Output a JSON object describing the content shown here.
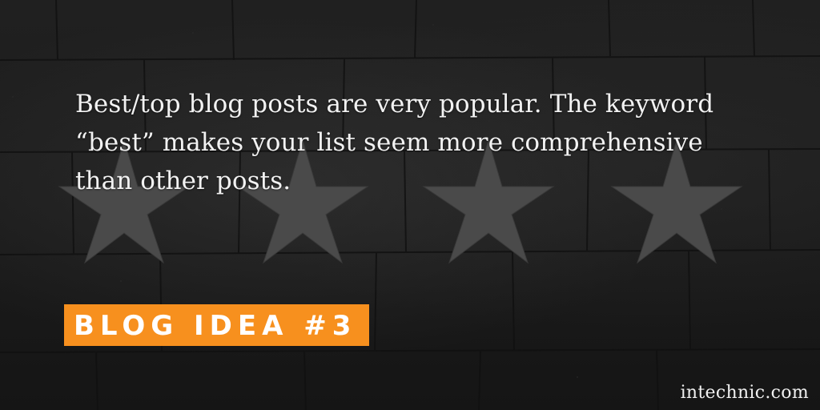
{
  "headline": {
    "lines": [
      "Best/top blog posts are very popular. The keyword",
      "“best” makes your list seem more comprehensive",
      "than other posts."
    ]
  },
  "badge": {
    "label": "BLOG IDEA #3"
  },
  "site": {
    "domain": "intechnic.com"
  },
  "decor": {
    "icons": [
      "star-icon",
      "star-icon",
      "star-icon",
      "star-icon"
    ],
    "accent_color": "#f7901e",
    "background_color": "#1b1b1b",
    "star_color": "#4a4a4a"
  }
}
